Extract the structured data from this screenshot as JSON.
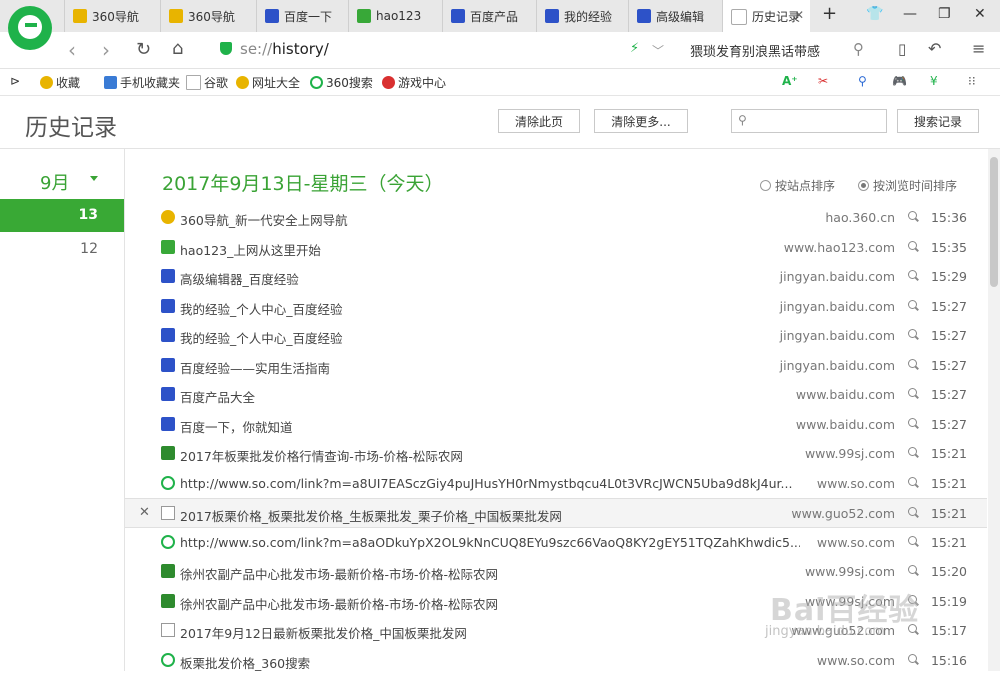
{
  "browser": {
    "tabs": [
      {
        "label": "360导航",
        "color": "#e8b400"
      },
      {
        "label": "360导航",
        "color": "#e8b400"
      },
      {
        "label": "百度一下",
        "color": "#2d52c8"
      },
      {
        "label": "hao123",
        "color": "#38a838"
      },
      {
        "label": "百度产品",
        "color": "#2d52c8"
      },
      {
        "label": "我的经验",
        "color": "#2d52c8"
      },
      {
        "label": "高级编辑",
        "color": "#2d52c8"
      },
      {
        "label": "历史记录",
        "color": "#aaaaaa"
      }
    ],
    "new_tab": "+",
    "url_prefix": "se://",
    "url_path": "history/",
    "search_suggest": "猥琐发育别浪黑话带感"
  },
  "bookmarks": [
    {
      "label": "收藏",
      "color": "#e8b400"
    },
    {
      "label": "手机收藏夹",
      "color": "#3a7bd5"
    },
    {
      "label": "谷歌",
      "color": "#bbbbbb"
    },
    {
      "label": "网址大全",
      "color": "#e8b400"
    },
    {
      "label": "360搜索",
      "color": "#1fb24a"
    },
    {
      "label": "游戏中心",
      "color": "#d93030"
    }
  ],
  "page": {
    "title": "历史记录",
    "clear_page": "清除此页",
    "clear_more": "清除更多...",
    "search_btn": "搜索记录",
    "month": "9月",
    "days": [
      "13",
      "12"
    ],
    "date_heading": "2017年9月13日-星期三（今天）",
    "sort_site": "按站点排序",
    "sort_time": "按浏览时间排序"
  },
  "history": [
    {
      "title": "360导航_新一代安全上网导航",
      "domain": "hao.360.cn",
      "time": "15:36",
      "icon": "#e8b400"
    },
    {
      "title": "hao123_上网从这里开始",
      "domain": "www.hao123.com",
      "time": "15:35",
      "icon": "#38a838"
    },
    {
      "title": "高级编辑器_百度经验",
      "domain": "jingyan.baidu.com",
      "time": "15:29",
      "icon": "#2d52c8"
    },
    {
      "title": "我的经验_个人中心_百度经验",
      "domain": "jingyan.baidu.com",
      "time": "15:27",
      "icon": "#2d52c8"
    },
    {
      "title": "我的经验_个人中心_百度经验",
      "domain": "jingyan.baidu.com",
      "time": "15:27",
      "icon": "#2d52c8"
    },
    {
      "title": "百度经验——实用生活指南",
      "domain": "jingyan.baidu.com",
      "time": "15:27",
      "icon": "#2d52c8"
    },
    {
      "title": "百度产品大全",
      "domain": "www.baidu.com",
      "time": "15:27",
      "icon": "#2d52c8"
    },
    {
      "title": "百度一下，你就知道",
      "domain": "www.baidu.com",
      "time": "15:27",
      "icon": "#2d52c8"
    },
    {
      "title": "2017年板栗批发价格行情查询-市场-价格-松际农网",
      "domain": "www.99sj.com",
      "time": "15:21",
      "icon": "#2e8b2e"
    },
    {
      "title": "http://www.so.com/link?m=a8UI7EASczGiy4puJHusYH0rNmystbqcu4L0t3VRcJWCN5Uba9d8kJ4ur...",
      "domain": "www.so.com",
      "time": "15:21",
      "icon": "#1fb24a"
    },
    {
      "title": "2017板栗价格_板栗批发价格_生板栗批发_栗子价格_中国板栗批发网",
      "domain": "www.guo52.com",
      "time": "15:21",
      "icon": "#cccccc"
    },
    {
      "title": "http://www.so.com/link?m=a8aODkuYpX2OL9kNnCUQ8EYu9szc66VaoQ8KY2gEY51TQZahKhwdic5...",
      "domain": "www.so.com",
      "time": "15:21",
      "icon": "#1fb24a"
    },
    {
      "title": "徐州农副产品中心批发市场-最新价格-市场-价格-松际农网",
      "domain": "www.99sj.com",
      "time": "15:20",
      "icon": "#2e8b2e"
    },
    {
      "title": "徐州农副产品中心批发市场-最新价格-市场-价格-松际农网",
      "domain": "www.99sj.com",
      "time": "15:19",
      "icon": "#2e8b2e"
    },
    {
      "title": "2017年9月12日最新板栗批发价格_中国板栗批发网",
      "domain": "www.guo52.com",
      "time": "15:17",
      "icon": "#cccccc"
    },
    {
      "title": "板栗批发价格_360搜索",
      "domain": "www.so.com",
      "time": "15:16",
      "icon": "#1fb24a"
    }
  ],
  "watermark": "Bai百经验",
  "watermark_url": "jingyan.baidu.com"
}
